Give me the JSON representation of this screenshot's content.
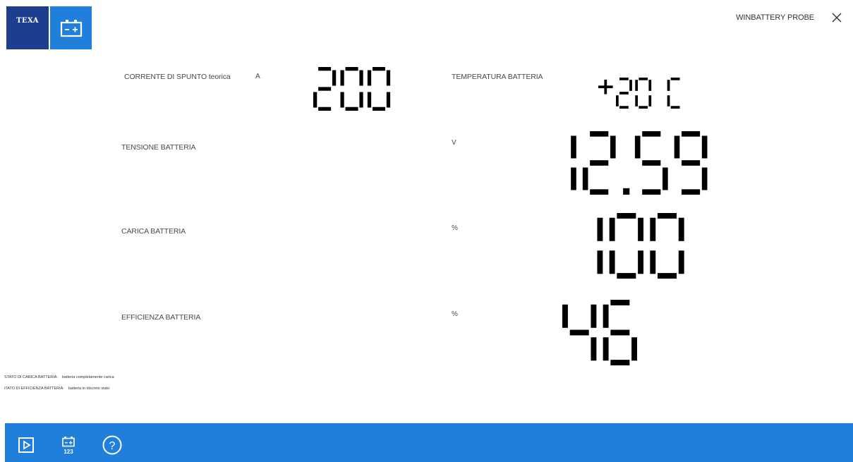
{
  "brand": {
    "logo_text": "TEXA",
    "logo_icon": "battery-icon"
  },
  "header": {
    "title": "WINBATTERY PROBE",
    "close_icon": "close-icon"
  },
  "readings": {
    "cranking": {
      "label": "CORRENTE DI SPUNTO teorica",
      "unit": "A",
      "value": "200"
    },
    "temperature": {
      "label": "TEMPERATURA BATTERIA",
      "value": "+20 C"
    },
    "voltage": {
      "label": "TENSIONE BATTERIA",
      "unit": "V",
      "value": "12.59"
    },
    "charge": {
      "label": "CARICA BATTERIA",
      "unit": "%",
      "value": "100"
    },
    "efficiency": {
      "label": "EFFICIENZA BATTERIA",
      "unit": "%",
      "value": "46"
    }
  },
  "status": {
    "charge_label": "STATO DI CARICA BATTERIA:",
    "charge_value": "batteria completamente carica",
    "efficiency_label": "iTATO DI EFFICIENZA BATTERIA:",
    "efficiency_value": "batteria in discreto stato"
  },
  "toolbar": {
    "items": [
      {
        "icon": "play-icon"
      },
      {
        "icon": "battery-123-icon",
        "text": "123"
      },
      {
        "icon": "help-icon",
        "text": "?"
      }
    ]
  },
  "colors": {
    "brand_dark": "#1d3d8f",
    "brand_blue": "#1f7fdb",
    "text": "#4a4a4a"
  }
}
